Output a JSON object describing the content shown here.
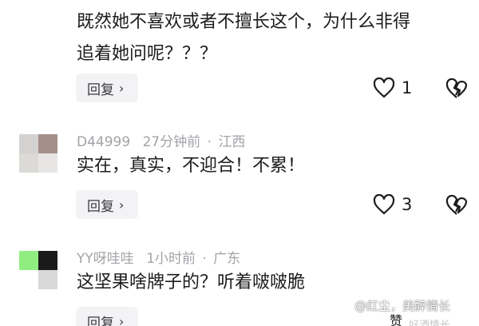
{
  "colors": {
    "text_primary": "#1c1c1e",
    "text_meta": "#a3a3a8",
    "button_bg": "#f3f3f5"
  },
  "comments": [
    {
      "avatar_colors": [
        "#e8dcdc",
        "#9a6a6a",
        "#ffffff",
        "#ffffff"
      ],
      "username": "",
      "time": "",
      "region": "",
      "lines": [
        "既然她不喜欢或者不擅长这个，为什么非得",
        "追着她问呢？？？"
      ],
      "reply_label": "回复",
      "like_count": "1",
      "like_icon": "heart-outline-icon",
      "dislike_icon": "broken-heart-icon"
    },
    {
      "avatar_colors": [
        "#d4d2d0",
        "#a58f8b",
        "#dcdad6",
        "#e8e6e4"
      ],
      "username": "D44999",
      "time": "27分钟前",
      "region": "江西",
      "lines": [
        "实在，真实，不迎合！不累！"
      ],
      "reply_label": "回复",
      "like_count": "3",
      "like_icon": "heart-outline-icon",
      "dislike_icon": "broken-heart-icon"
    },
    {
      "avatar_colors": [
        "#90ee80",
        "#1a1a1a",
        "#ffffff",
        "#d8d8d8"
      ],
      "username": "YY呀哇哇",
      "time": "1小时前",
      "region": "广东",
      "lines": [
        "这坚果啥牌子的？听着啵啵脆"
      ],
      "reply_label": "回复",
      "like_count": "",
      "like_icon": "",
      "dislike_icon": ""
    }
  ],
  "separator": "·",
  "watermark": "@红尘，美醉情长",
  "watermark_sub": "好酒情长",
  "bottom_partial_icon": "赞"
}
